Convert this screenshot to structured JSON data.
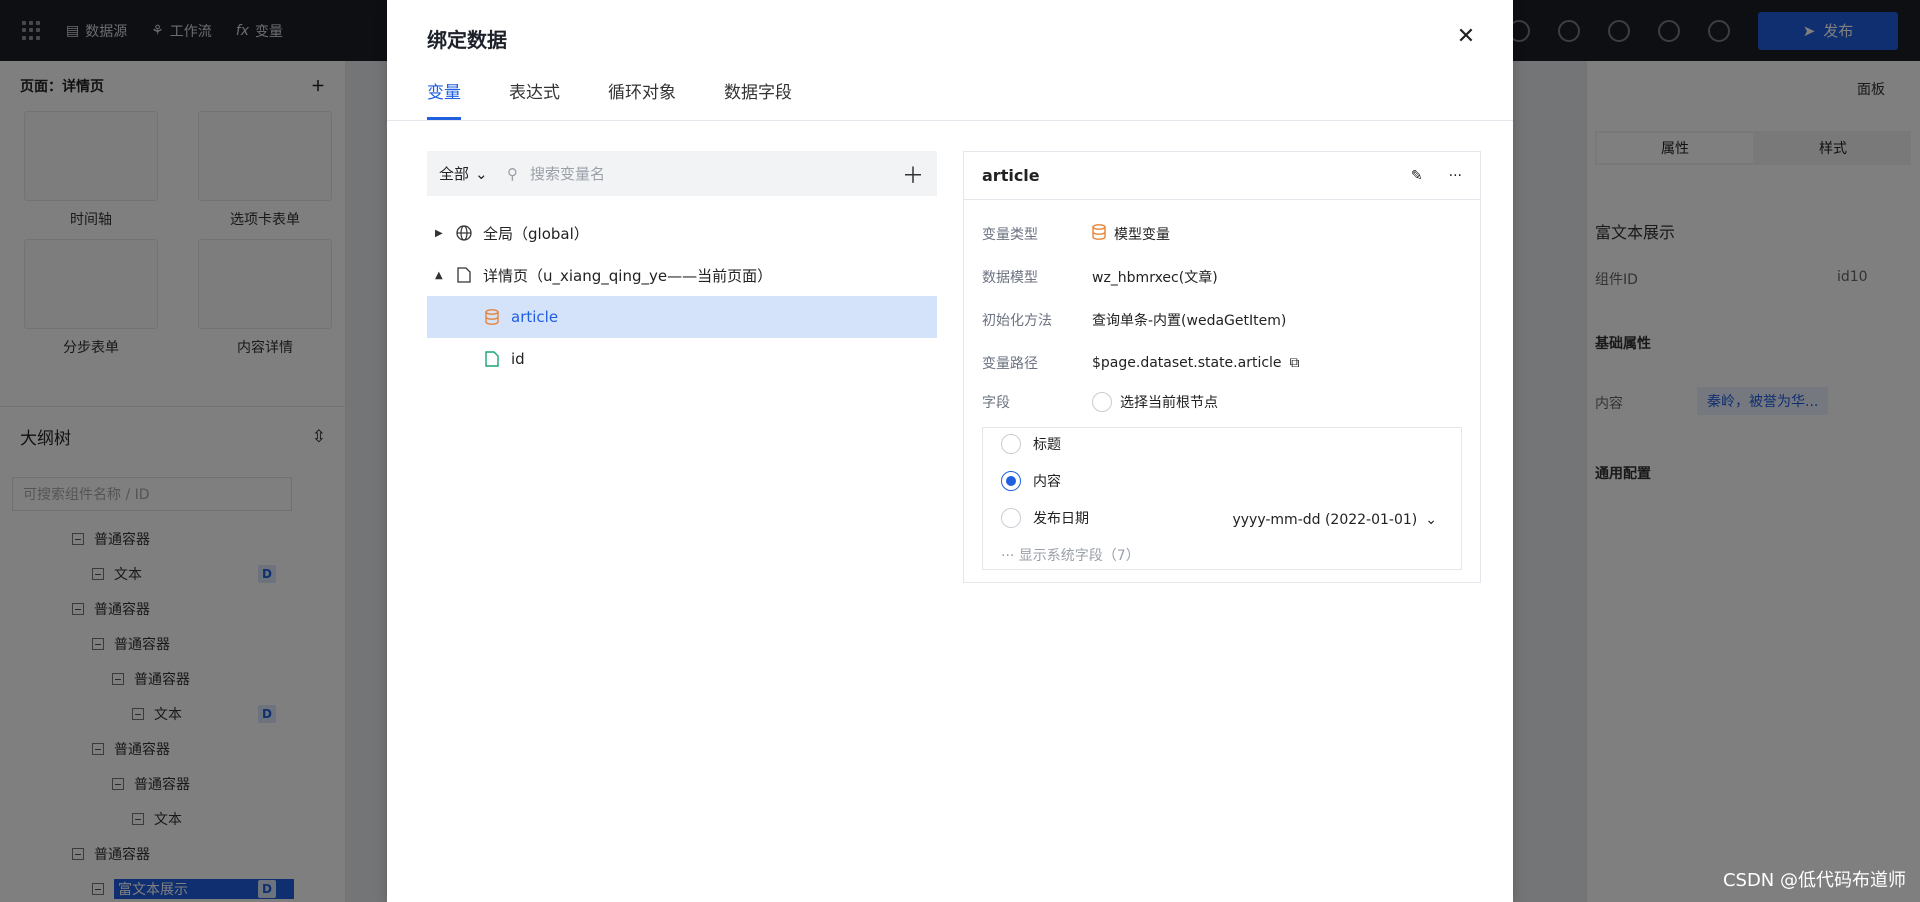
{
  "topbar": {
    "items": [
      "数据源",
      "工作流",
      "变量"
    ],
    "publish_label": "发布"
  },
  "left_panel": {
    "page_label": "页面：详情页",
    "components": [
      "时间轴",
      "选项卡表单",
      "分步表单",
      "内容详情"
    ],
    "outline_title": "大纲树",
    "outline_search_placeholder": "可搜索组件名称 / ID",
    "tree": [
      {
        "label": "普通容器",
        "indent": 1
      },
      {
        "label": "文本",
        "indent": 2,
        "badge": "D"
      },
      {
        "label": "普通容器",
        "indent": 1
      },
      {
        "label": "普通容器",
        "indent": 2
      },
      {
        "label": "普通容器",
        "indent": 3
      },
      {
        "label": "文本",
        "indent": 4,
        "badge": "D"
      },
      {
        "label": "普通容器",
        "indent": 2
      },
      {
        "label": "普通容器",
        "indent": 3
      },
      {
        "label": "文本",
        "indent": 4
      },
      {
        "label": "普通容器",
        "indent": 1
      },
      {
        "label": "富文本展示",
        "indent": 2,
        "badge": "D",
        "selected": true
      }
    ]
  },
  "right_panel": {
    "panel_label": "面板",
    "tabs": [
      "属性",
      "样式"
    ],
    "component_name": "富文本展示",
    "component_id_label": "组件ID",
    "component_id": "id10",
    "basic_props": "基础属性",
    "content_label": "内容",
    "content_value": "秦岭，被誉为华...",
    "general_config": "通用配置"
  },
  "modal": {
    "title": "绑定数据",
    "tabs": [
      "变量",
      "表达式",
      "循环对象",
      "数据字段"
    ],
    "active_tab": 0,
    "filter_label": "全部",
    "search_placeholder": "搜索变量名",
    "tree": {
      "global_label": "全局（global）",
      "page_label": "详情页（u_xiang_qing_ye——当前页面）",
      "vars": [
        {
          "name": "article",
          "icon": "database-icon"
        },
        {
          "name": "id",
          "icon": "file-icon"
        }
      ]
    },
    "detail": {
      "name": "article",
      "rows": [
        {
          "k": "变量类型",
          "v": "模型变量"
        },
        {
          "k": "数据模型",
          "v": "wz_hbmrxec(文章)"
        },
        {
          "k": "初始化方法",
          "v": "查询单条-内置(wedaGetItem)"
        },
        {
          "k": "变量路径",
          "v": "$page.dataset.state.article"
        },
        {
          "k": "字段",
          "v": "选择当前根节点"
        }
      ],
      "fields": [
        {
          "label": "标题",
          "checked": false
        },
        {
          "label": "内容",
          "checked": true
        },
        {
          "label": "发布日期",
          "checked": false
        }
      ],
      "date_format": "yyyy-mm-dd (2022-01-01)",
      "show_system_fields": "··· 显示系统字段（7）"
    }
  },
  "watermark": "CSDN @低代码布道师",
  "colors": {
    "accent": "#1f5fe0",
    "selected_bg": "#d4e2fa"
  }
}
